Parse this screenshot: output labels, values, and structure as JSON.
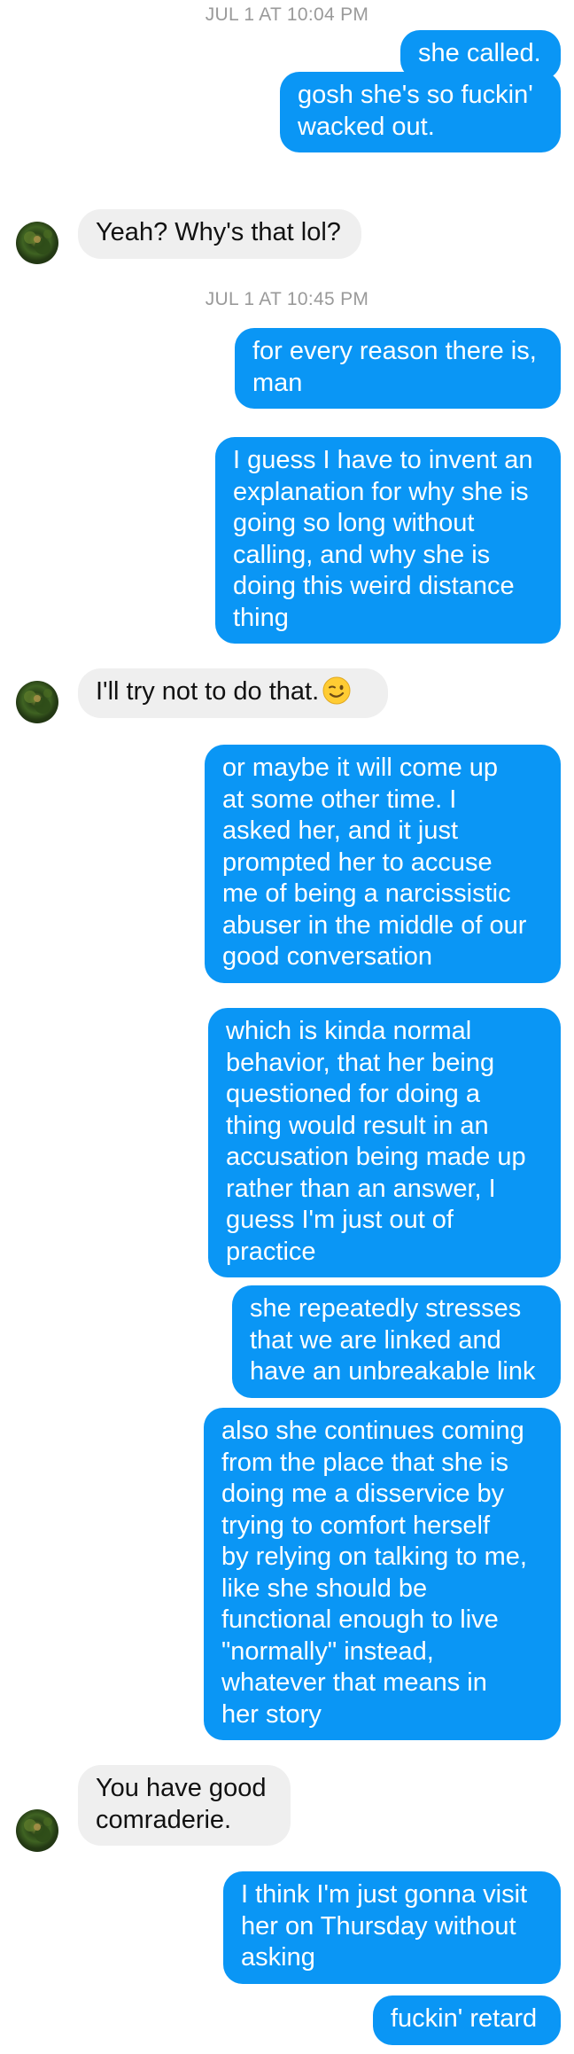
{
  "timestamps": [
    "JUL 1 AT 10:04 PM",
    "JUL 1 AT 10:45 PM"
  ],
  "messages": [
    {
      "sender": "me",
      "text": "she called."
    },
    {
      "sender": "me",
      "text": "gosh she's so fuckin'\nwacked out."
    },
    {
      "sender": "contact",
      "text": "Yeah? Why's that lol?"
    },
    {
      "sender": "me",
      "text": "for every reason there is,\nman"
    },
    {
      "sender": "me",
      "text": "I guess I have to invent an\nexplanation for why she is\ngoing so long without\ncalling, and why she is\ndoing this weird distance\nthing"
    },
    {
      "sender": "contact",
      "text": "I'll try not to do that.",
      "emoji": "winking-face-emoji"
    },
    {
      "sender": "me",
      "text": "or maybe it will come up\nat some other time. I\nasked her, and it just\nprompted her to accuse\nme of being a narcissistic\nabuser in the middle of our\ngood conversation"
    },
    {
      "sender": "me",
      "text": "which is kinda normal\nbehavior, that her being\nquestioned for doing a\nthing would result in an\naccusation being made up\nrather than an answer, I\nguess I'm just out of\npractice"
    },
    {
      "sender": "me",
      "text": "she repeatedly stresses\nthat we are linked and\nhave an unbreakable link"
    },
    {
      "sender": "me",
      "text": "also she continues coming\nfrom the place that she is\ndoing me a disservice by\ntrying to comfort herself\nby relying on talking to me,\nlike she should be\nfunctional enough to live\n\"normally\" instead,\nwhatever that means in\nher story"
    },
    {
      "sender": "contact",
      "text": "You have good\ncomraderie."
    },
    {
      "sender": "me",
      "text": "I think I'm just gonna visit\nher on Thursday without\nasking"
    },
    {
      "sender": "me",
      "text": "fuckin' retard"
    }
  ],
  "colors": {
    "outgoing_bubble": "#0a96f5",
    "incoming_bubble": "#efefef",
    "timestamp": "#9a9a9a",
    "background": "#ffffff"
  },
  "icons": {
    "contact_avatar": "contact-avatar",
    "emoji": "winking-face-emoji"
  }
}
